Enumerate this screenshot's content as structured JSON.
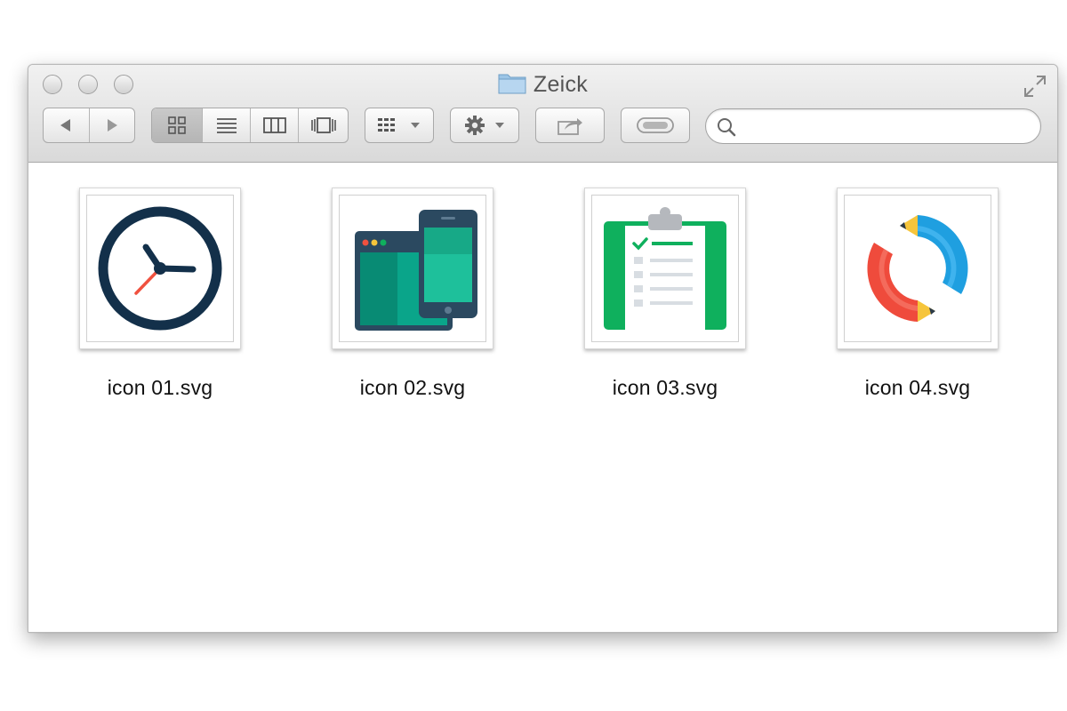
{
  "window": {
    "title": "Zeick",
    "folder_icon": "folder-icon"
  },
  "toolbar": {
    "back_icon": "back-arrow-icon",
    "forward_icon": "forward-arrow-icon",
    "view_modes": [
      "icon-view-icon",
      "list-view-icon",
      "column-view-icon",
      "cover-flow-icon"
    ],
    "active_view": "icon-view-icon",
    "arrange_icon": "arrange-grid-icon",
    "action_icon": "gear-icon",
    "share_icon": "share-icon",
    "tags_icon": "tag-toggle-icon"
  },
  "search": {
    "placeholder": "",
    "value": ""
  },
  "files": [
    {
      "name": "icon 01.svg",
      "icon": "clock-icon"
    },
    {
      "name": "icon 02.svg",
      "icon": "browser-phone-icon"
    },
    {
      "name": "icon 03.svg",
      "icon": "clipboard-checklist-icon"
    },
    {
      "name": "icon 04.svg",
      "icon": "sync-arrows-icon"
    }
  ],
  "colors": {
    "clock_navy": "#13304a",
    "clock_hand_red": "#f0513f",
    "device_teal": "#0aa58a",
    "device_navy": "#2b4960",
    "clipboard_green": "#0fb05d",
    "arrow_blue": "#1f9fe0",
    "arrow_red": "#ef4b3c",
    "pencil_yellow": "#f6c53b"
  }
}
